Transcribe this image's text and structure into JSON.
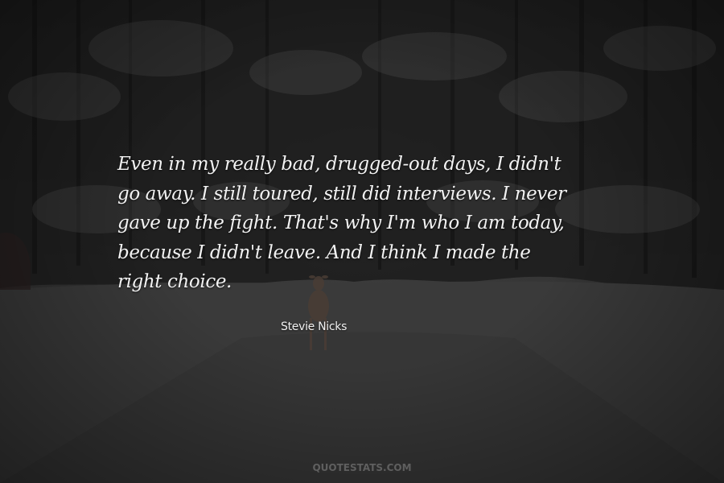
{
  "quote": {
    "lines": [
      "Even in my really bad, drugged-out days, I didn't",
      "go away. I still toured, still did interviews. I never",
      "gave up the fight. That's why I'm who I am today,",
      "because I didn't leave. And I think I made the",
      "right choice."
    ]
  },
  "author": "Stevie Nicks",
  "watermark": "QUOTESTATS.COM",
  "colors": {
    "text": "#f2f2f2",
    "background": "#2b2b2b",
    "watermark": "#5f5f5f"
  }
}
